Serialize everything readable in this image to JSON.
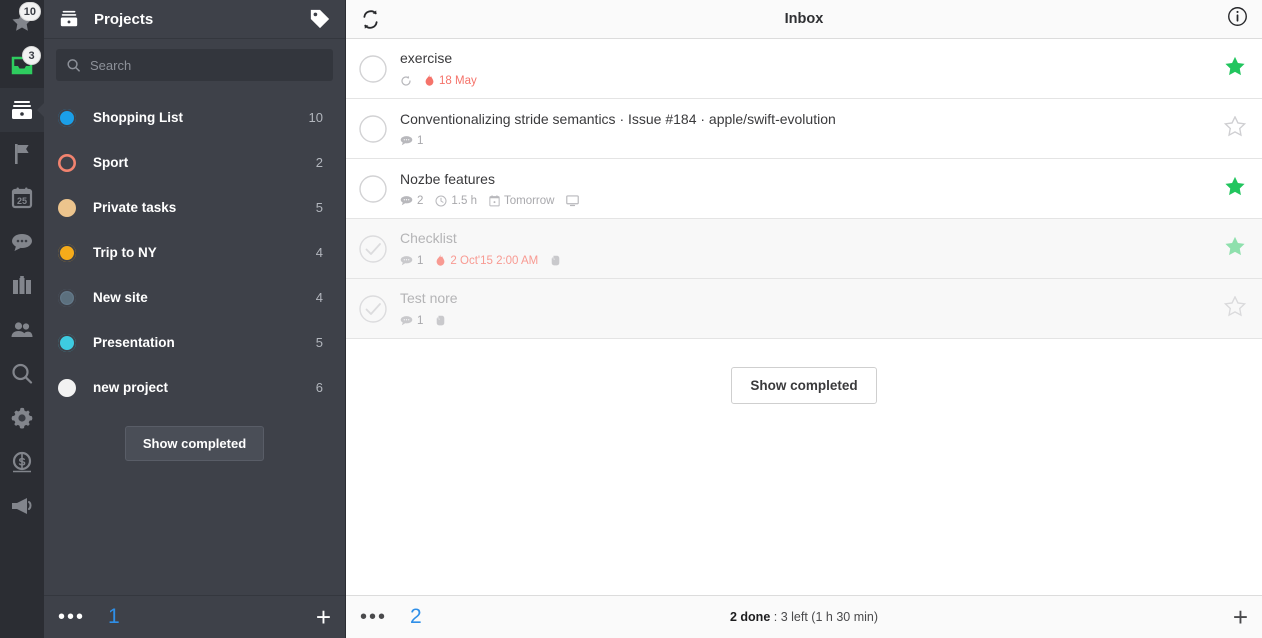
{
  "rail": {
    "items": [
      {
        "name": "priority-star-icon",
        "icon": "star",
        "badge": "10",
        "active": false
      },
      {
        "name": "inbox-icon",
        "icon": "inbox",
        "badge": "3",
        "active": false
      },
      {
        "name": "projects-icon",
        "icon": "archive",
        "badge": "",
        "active": true
      },
      {
        "name": "flag-icon",
        "icon": "flag",
        "badge": "",
        "active": false
      },
      {
        "name": "calendar-icon",
        "icon": "calendar",
        "badge": "25",
        "active": false
      },
      {
        "name": "comments-icon",
        "icon": "comments",
        "badge": "",
        "active": false
      },
      {
        "name": "briefcase-icon",
        "icon": "briefcase",
        "badge": "",
        "active": false
      },
      {
        "name": "team-icon",
        "icon": "people",
        "badge": "",
        "active": false
      },
      {
        "name": "search-icon",
        "icon": "search",
        "badge": "",
        "active": false
      },
      {
        "name": "settings-icon",
        "icon": "gear",
        "badge": "",
        "active": false
      },
      {
        "name": "billing-icon",
        "icon": "dollar",
        "badge": "",
        "active": false
      },
      {
        "name": "announcements-icon",
        "icon": "megaphone",
        "badge": "",
        "active": false
      }
    ]
  },
  "sidebar": {
    "title": "Projects",
    "header_icon": "archive-icon",
    "tag_icon": "tag-icon",
    "search": {
      "placeholder": "Search",
      "value": ""
    },
    "projects": [
      {
        "label": "Shopping List",
        "count": "10",
        "color": "#1b9fe8",
        "style": "ring-filled"
      },
      {
        "label": "Sport",
        "count": "2",
        "color": "#f2836f",
        "style": "ring"
      },
      {
        "label": "Private tasks",
        "count": "5",
        "color": "#ecc48d",
        "style": "solid"
      },
      {
        "label": "Trip to NY",
        "count": "4",
        "color": "#f5ab1a",
        "style": "ring-filled"
      },
      {
        "label": "New site",
        "count": "4",
        "color": "#63798a",
        "style": "ring"
      },
      {
        "label": "Presentation",
        "count": "5",
        "color": "#3ecbe0",
        "style": "ring-filled"
      },
      {
        "label": "new project",
        "count": "6",
        "color": "#f2f2f2",
        "style": "solid"
      }
    ],
    "show_completed_label": "Show completed",
    "footer": {
      "menu": "•••",
      "number": "1",
      "add": "+"
    }
  },
  "main": {
    "title": "Inbox",
    "refresh_icon": "refresh-icon",
    "info_icon": "info-icon",
    "tasks": [
      {
        "title": "exercise",
        "completed": false,
        "starred": true,
        "star_style": "filled",
        "meta": [
          {
            "icon": "repeat-icon",
            "text": "",
            "red": false
          },
          {
            "icon": "flame-icon",
            "text": "18 May",
            "red": true
          }
        ]
      },
      {
        "title": "Conventionalizing stride semantics · Issue #184 · apple/swift-evolution",
        "completed": false,
        "starred": false,
        "star_style": "outline",
        "meta": [
          {
            "icon": "comment-icon",
            "text": "1",
            "red": false
          }
        ]
      },
      {
        "title": "Nozbe features",
        "completed": false,
        "starred": true,
        "star_style": "filled",
        "meta": [
          {
            "icon": "comment-icon",
            "text": "2",
            "red": false
          },
          {
            "icon": "clock-icon",
            "text": "1.5 h",
            "red": false
          },
          {
            "icon": "calendar-icon",
            "text": "Tomorrow",
            "red": false
          },
          {
            "icon": "monitor-icon",
            "text": "",
            "red": false
          }
        ]
      },
      {
        "title": "Checklist",
        "completed": true,
        "starred": true,
        "star_style": "faded",
        "meta": [
          {
            "icon": "comment-icon",
            "text": "1",
            "red": false
          },
          {
            "icon": "flame-icon",
            "text": "2 Oct'15 2:00 AM",
            "red": true
          },
          {
            "icon": "evernote-icon",
            "text": "",
            "red": false
          }
        ]
      },
      {
        "title": "Test nore",
        "completed": true,
        "starred": false,
        "star_style": "outline-faded",
        "meta": [
          {
            "icon": "comment-icon",
            "text": "1",
            "red": false
          },
          {
            "icon": "evernote-icon",
            "text": "",
            "red": false
          }
        ]
      }
    ],
    "show_completed_label": "Show completed",
    "footer": {
      "menu": "•••",
      "number": "2",
      "done_count": "2 done",
      "separator": ":",
      "remaining": "3 left (1 h 30 min)",
      "add": "+"
    }
  },
  "colors": {
    "rail_bg": "#2b2d33",
    "sidebar_bg": "#3e4149",
    "accent_blue": "#2f8fe8",
    "star_green": "#22c55e",
    "star_green_faded": "#8fe0ad",
    "red": "#f5736a"
  }
}
